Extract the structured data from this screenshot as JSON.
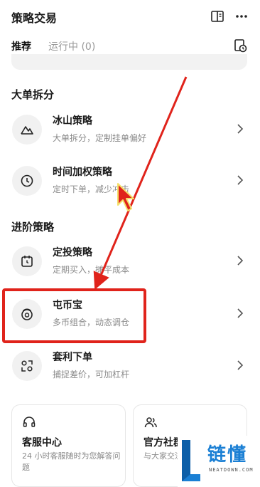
{
  "header": {
    "title": "策略交易"
  },
  "tabs": [
    {
      "label": "推荐"
    },
    {
      "label": "运行中 (0)"
    }
  ],
  "sections": [
    {
      "title": "大单拆分",
      "items": [
        {
          "name": "冰山策略",
          "desc": "大单拆分，定制挂单偏好",
          "icon": "mountain-icon"
        },
        {
          "name": "时间加权策略",
          "desc": "定时下单，减少冲击",
          "icon": "clock-icon"
        }
      ]
    },
    {
      "title": "进阶策略",
      "items": [
        {
          "name": "定投策略",
          "desc": "定期买入，摊平成本",
          "icon": "calendar-icon"
        },
        {
          "name": "屯币宝",
          "desc": "多币组合，动态调仓",
          "icon": "coin-icon"
        },
        {
          "name": "套利下单",
          "desc": "捕捉差价，可加杠杆",
          "icon": "scan-icon"
        }
      ]
    }
  ],
  "cards": [
    {
      "title": "客服中心",
      "desc": "24 小时客服随时为您解答问题",
      "icon": "headset-icon"
    },
    {
      "title": "官方社群",
      "desc": "与大家交流策略交易",
      "icon": "users-icon"
    }
  ],
  "watermark": {
    "text": "链懂",
    "sub": "NEATDOWN.COM"
  },
  "colors": {
    "annotation": "#e0231b",
    "watermark": "#1a7fd4"
  }
}
